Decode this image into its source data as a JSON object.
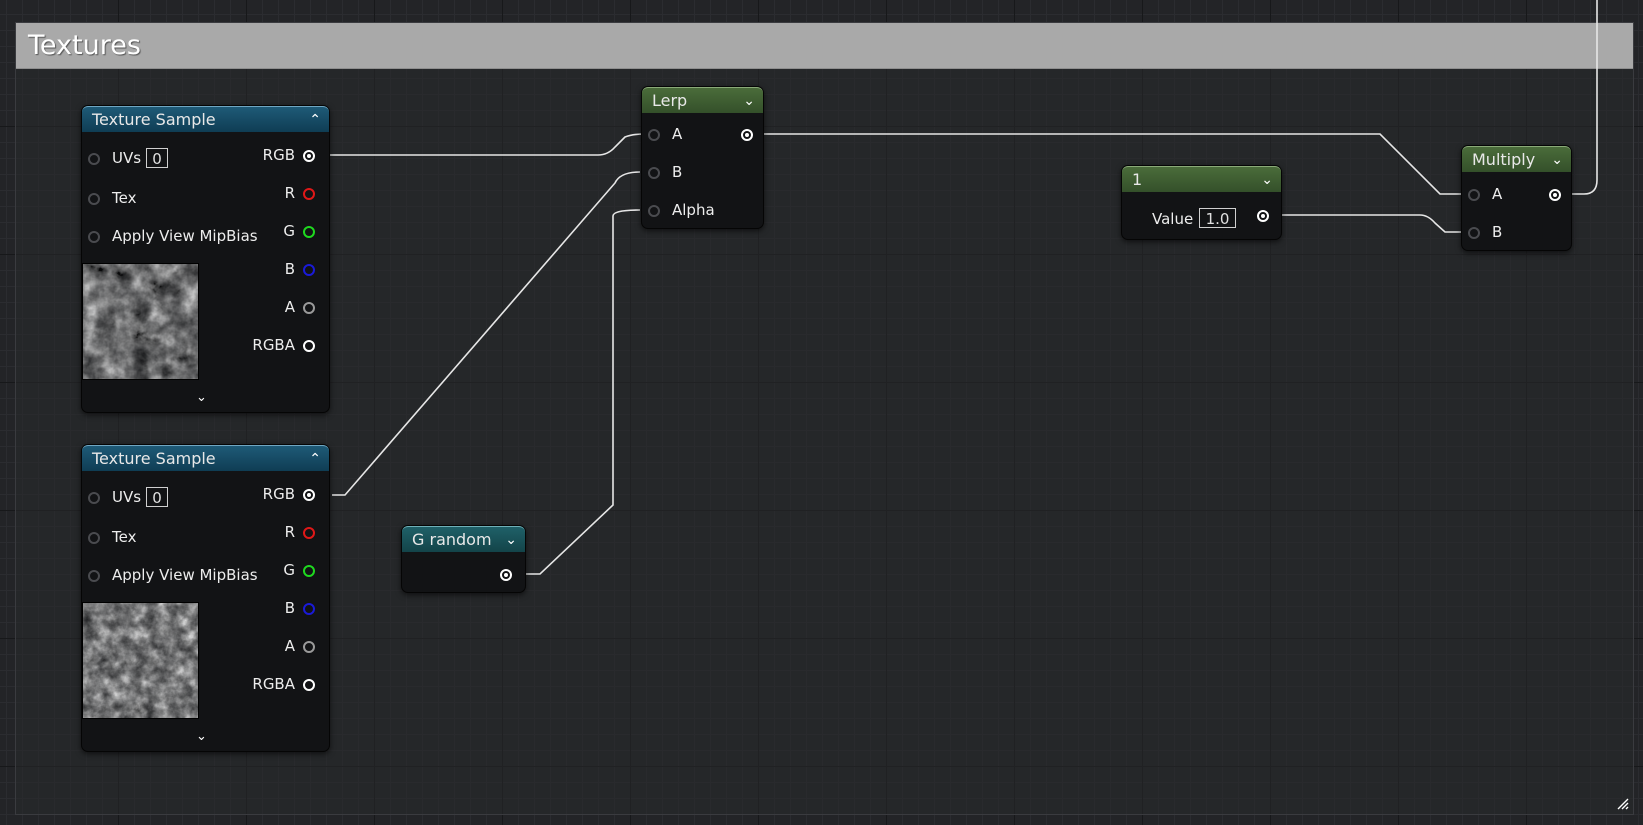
{
  "comment": {
    "title": "Textures"
  },
  "texture_sample_1": {
    "title": "Texture Sample",
    "inputs": {
      "uvs": "UVs",
      "uvs_value": "0",
      "tex": "Tex",
      "mipbias": "Apply View MipBias"
    },
    "outputs": {
      "rgb": "RGB",
      "r": "R",
      "g": "G",
      "b": "B",
      "a": "A",
      "rgba": "RGBA"
    }
  },
  "texture_sample_2": {
    "title": "Texture Sample",
    "inputs": {
      "uvs": "UVs",
      "uvs_value": "0",
      "tex": "Tex",
      "mipbias": "Apply View MipBias"
    },
    "outputs": {
      "rgb": "RGB",
      "r": "R",
      "g": "G",
      "b": "B",
      "a": "A",
      "rgba": "RGBA"
    }
  },
  "lerp": {
    "title": "Lerp",
    "inputs": {
      "a": "A",
      "b": "B",
      "alpha": "Alpha"
    }
  },
  "constant": {
    "title": "1",
    "value_label": "Value",
    "value": "1.0"
  },
  "multiply": {
    "title": "Multiply",
    "inputs": {
      "a": "A",
      "b": "B"
    }
  },
  "g_random": {
    "title": "G random"
  },
  "icons": {
    "collapse": "chevron-up-icon",
    "dropdown": "chevron-down-icon",
    "expand": "chevron-down-icon",
    "resize": "resize-grip-icon"
  },
  "colors": {
    "texture_header": "#0f3d54",
    "math_header": "#34502a",
    "param_header": "#134449",
    "pin_r": "#e01818",
    "pin_g": "#1fd81f",
    "pin_b": "#1a1ad8",
    "wire": "#e0e0e0",
    "comment_header": "#a9a9a9"
  }
}
